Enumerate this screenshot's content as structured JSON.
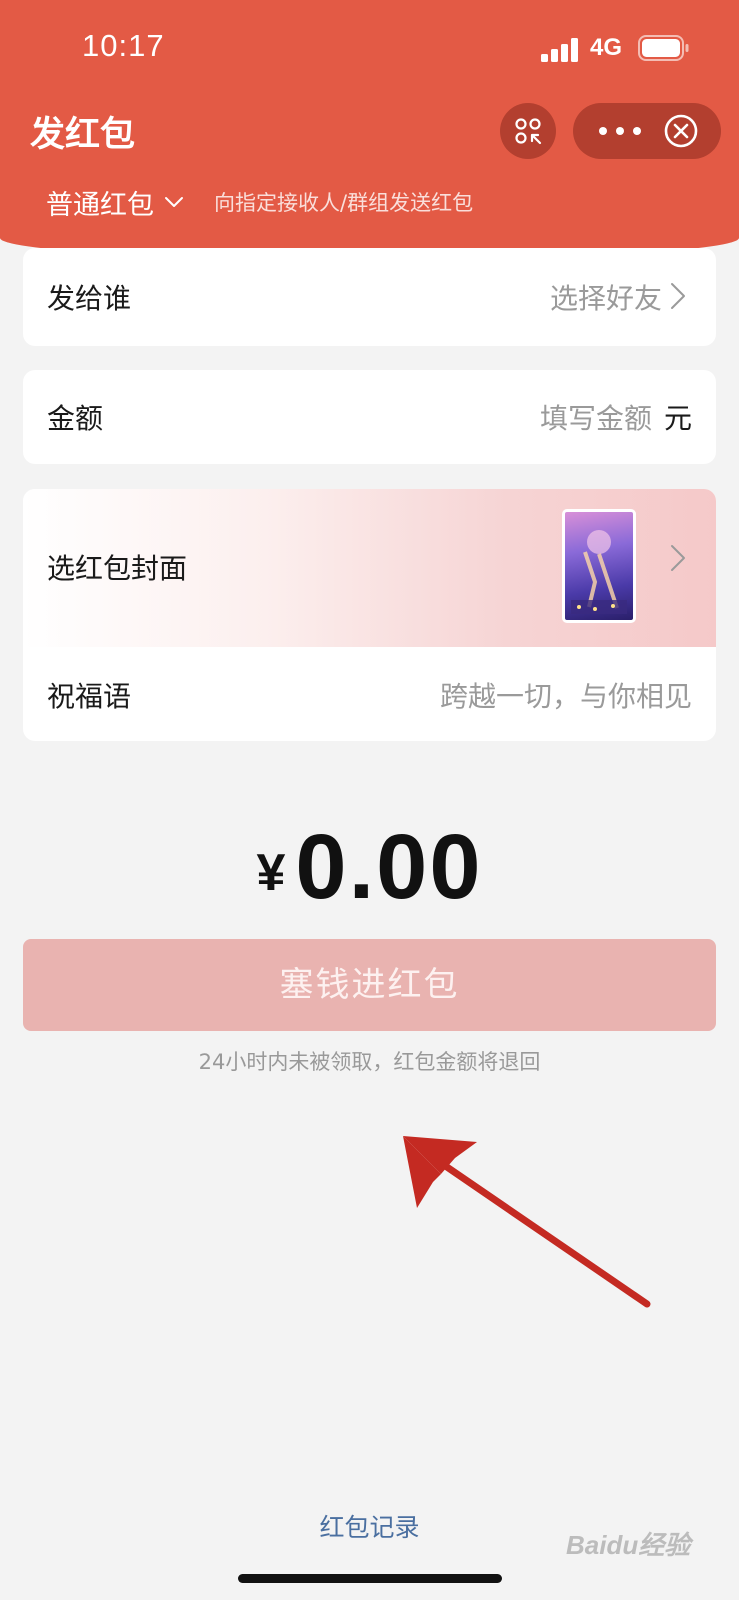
{
  "status_bar": {
    "time": "10:17",
    "network": "4G"
  },
  "header": {
    "title": "发红包"
  },
  "packet_type": {
    "label": "普通红包",
    "description": "向指定接收人/群组发送红包"
  },
  "recipient": {
    "label": "发给谁",
    "value": "选择好友"
  },
  "amount_row": {
    "label": "金额",
    "placeholder": "填写金额",
    "unit": "元"
  },
  "cover": {
    "label": "选红包封面"
  },
  "greeting": {
    "label": "祝福语",
    "placeholder": "跨越一切，与你相见"
  },
  "total": {
    "currency": "¥",
    "value": "0.00"
  },
  "submit": {
    "label": "塞钱进红包"
  },
  "note": "24小时内未被领取，红包金额将退回",
  "footer": {
    "records_link": "红包记录"
  },
  "watermark": {
    "text": "Baidu经验"
  },
  "colors": {
    "brand_red": "#e35a45",
    "button_disabled": "#e9b3b0",
    "link_blue": "#4a6fa0",
    "annotation_arrow": "#c42a22"
  }
}
